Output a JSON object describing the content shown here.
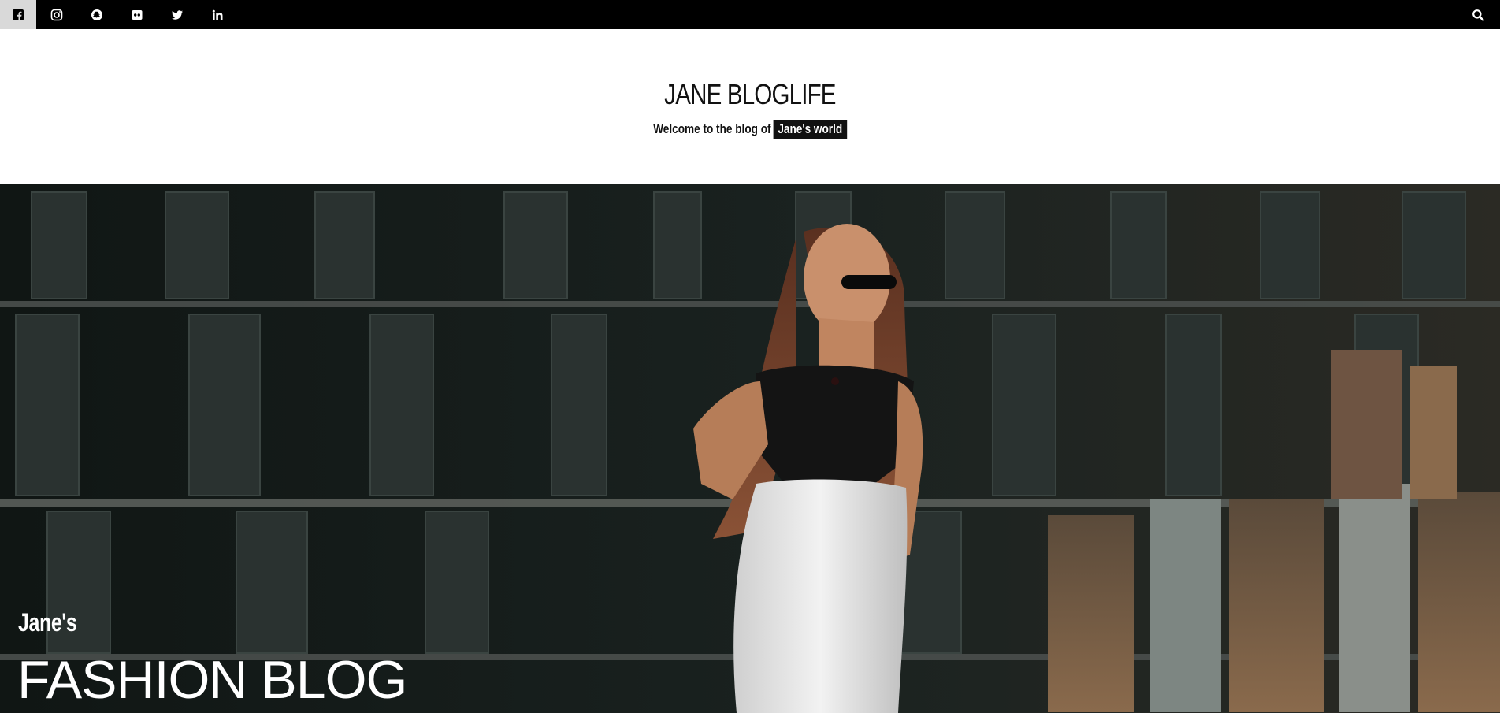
{
  "topbar": {
    "social": [
      {
        "icon": "facebook-icon",
        "active": true
      },
      {
        "icon": "instagram-icon",
        "active": false
      },
      {
        "icon": "snapchat-icon",
        "active": false
      },
      {
        "icon": "flickr-icon",
        "active": false
      },
      {
        "icon": "twitter-icon",
        "active": false
      },
      {
        "icon": "linkedin-icon",
        "active": false
      }
    ],
    "search_icon": "search-icon"
  },
  "header": {
    "title": "JANE BLOGLIFE",
    "tagline_prefix": "Welcome to the blog of",
    "tagline_highlight": "Jane's world"
  },
  "hero": {
    "kicker": "Jane's",
    "title": "FASHION BLOG"
  },
  "colors": {
    "topbar_bg": "#000000",
    "active_social_bg": "#d9d9d9",
    "text_dark": "#111111",
    "hero_text": "#ffffff"
  }
}
